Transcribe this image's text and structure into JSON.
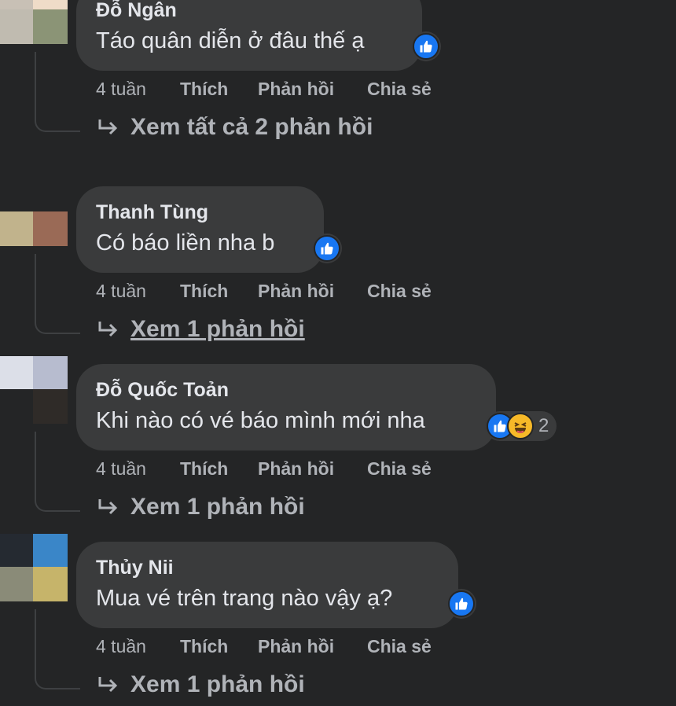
{
  "comments": [
    {
      "author": "Đỗ Ngân",
      "text": "Táo quân diễn ở đâu thế ạ",
      "time": "4 tuần",
      "like": "Thích",
      "reply": "Phản hồi",
      "share": "Chia sẻ",
      "view_replies": "Xem tất cả 2 phản hồi",
      "reactions": [
        "like-icon"
      ],
      "reaction_count": "",
      "avatar_colors": [
        "#c8c0b5",
        "#efdcc8",
        "#c0bbb0",
        "#8b9476"
      ]
    },
    {
      "author": "Thanh Tùng",
      "text": "Có báo liền nha b",
      "time": "4 tuần",
      "like": "Thích",
      "reply": "Phản hồi",
      "share": "Chia sẻ",
      "view_replies": "Xem 1 phản hồi",
      "reactions": [
        "like-icon"
      ],
      "reaction_count": "",
      "avatar_colors": [
        "#242526",
        "#242526",
        "#c1b38c",
        "#9a6a56"
      ]
    },
    {
      "author": "Đỗ Quốc Toản",
      "text": "Khi nào có vé báo mình mới nha",
      "time": "4 tuần",
      "like": "Thích",
      "reply": "Phản hồi",
      "share": "Chia sẻ",
      "view_replies": "Xem 1 phản hồi",
      "reactions": [
        "like-icon",
        "haha-icon"
      ],
      "reaction_count": "2",
      "avatar_colors": [
        "#dcdfe8",
        "#b7bccf",
        "#242526",
        "#2f2b28"
      ]
    },
    {
      "author": "Thủy Nii",
      "text": "Mua vé trên trang nào vậy ạ?",
      "time": "4 tuần",
      "like": "Thích",
      "reply": "Phản hồi",
      "share": "Chia sẻ",
      "view_replies": "Xem 1 phản hồi",
      "reactions": [
        "like-icon"
      ],
      "reaction_count": "",
      "avatar_colors": [
        "#252a31",
        "#3a86c8",
        "#8a8b78",
        "#c6b46a"
      ]
    }
  ],
  "colors": {
    "background": "#242526",
    "bubble": "#3a3b3c",
    "primary_text": "#e4e6eb",
    "secondary_text": "#b0b3b8",
    "like_blue": "#1877f2",
    "haha_yellow": "#f7b928"
  }
}
